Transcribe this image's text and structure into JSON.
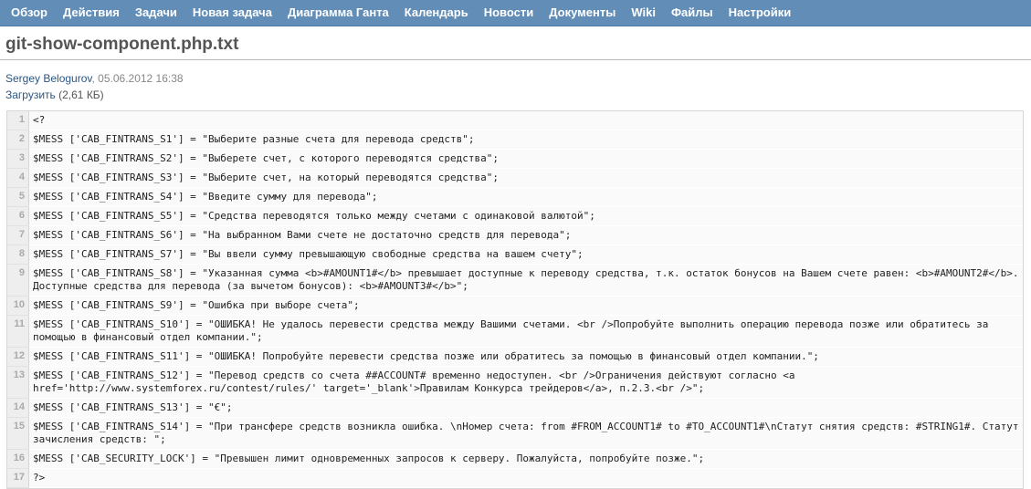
{
  "nav": {
    "items": [
      "Обзор",
      "Действия",
      "Задачи",
      "Новая задача",
      "Диаграмма Ганта",
      "Календарь",
      "Новости",
      "Документы",
      "Wiki",
      "Файлы",
      "Настройки"
    ]
  },
  "page": {
    "title": "git-show-component.php.txt",
    "author": "Sergey Belogurov",
    "date": ", 05.06.2012 16:38",
    "download_label": "Загрузить",
    "download_size": " (2,61 КБ)"
  },
  "code": {
    "lines": [
      {
        "n": "1",
        "text": "<?"
      },
      {
        "n": "2",
        "text": "$MESS ['CAB_FINTRANS_S1'] = \"Выберите разные счета для перевода средств\";"
      },
      {
        "n": "3",
        "text": "$MESS ['CAB_FINTRANS_S2'] = \"Выберете счет, с которого переводятся средства\";"
      },
      {
        "n": "4",
        "text": "$MESS ['CAB_FINTRANS_S3'] = \"Выберите счет, на который переводятся средства\";"
      },
      {
        "n": "5",
        "text": "$MESS ['CAB_FINTRANS_S4'] = \"Введите сумму для перевода\";"
      },
      {
        "n": "6",
        "text": "$MESS ['CAB_FINTRANS_S5'] = \"Средства переводятся только между счетами с одинаковой валютой\";"
      },
      {
        "n": "7",
        "text": "$MESS ['CAB_FINTRANS_S6'] = \"На выбранном Вами счете не достаточно средств для перевода\";"
      },
      {
        "n": "8",
        "text": "$MESS ['CAB_FINTRANS_S7'] = \"Вы ввели сумму превышающую свободные средства на вашем счету\";"
      },
      {
        "n": "9",
        "text": "$MESS ['CAB_FINTRANS_S8'] = \"Указанная сумма <b>#AMOUNT1#</b> превышает доступные к переводу средства, т.к. остаток бонусов на Вашем счете равен: <b>#AMOUNT2#</b>. Доступные средства для перевода (за вычетом бонусов): <b>#AMOUNT3#</b>\";"
      },
      {
        "n": "10",
        "text": "$MESS ['CAB_FINTRANS_S9'] = \"Ошибка при выборе счета\";"
      },
      {
        "n": "11",
        "text": "$MESS ['CAB_FINTRANS_S10'] = \"ОШИБКА! Не удалось перевести средства между Вашими счетами. <br />Попробуйте выполнить операцию перевода позже или обратитесь за помощью в финансовый отдел компании.\";"
      },
      {
        "n": "12",
        "text": "$MESS ['CAB_FINTRANS_S11'] = \"ОШИБКА! Попробуйте перевести средства позже или обратитесь за помощью в финансовый отдел компании.\";"
      },
      {
        "n": "13",
        "text": "$MESS ['CAB_FINTRANS_S12'] = \"Перевод средств со счета ##ACCOUNT# временно недоступен. <br />Ограничения действуют согласно <a href='http://www.systemforex.ru/contest/rules/' target='_blank'>Правилам Конкурса трейдеров</a>, п.2.3.<br />\";"
      },
      {
        "n": "14",
        "text": "$MESS ['CAB_FINTRANS_S13'] = \"€\";"
      },
      {
        "n": "15",
        "text": "$MESS ['CAB_FINTRANS_S14'] = \"При трансфере средств возникла ошибка. \\nНомер счета: from #FROM_ACCOUNT1# to #TO_ACCOUNT1#\\nСтатут снятия средств: #STRING1#. Статут зачисления средств: \";"
      },
      {
        "n": "16",
        "text": "$MESS ['CAB_SECURITY_LOCK'] = \"Превышен лимит одновременных запросов к серверу. Пожалуйста, попробуйте позже.\";"
      },
      {
        "n": "17",
        "text": "?>"
      }
    ]
  }
}
